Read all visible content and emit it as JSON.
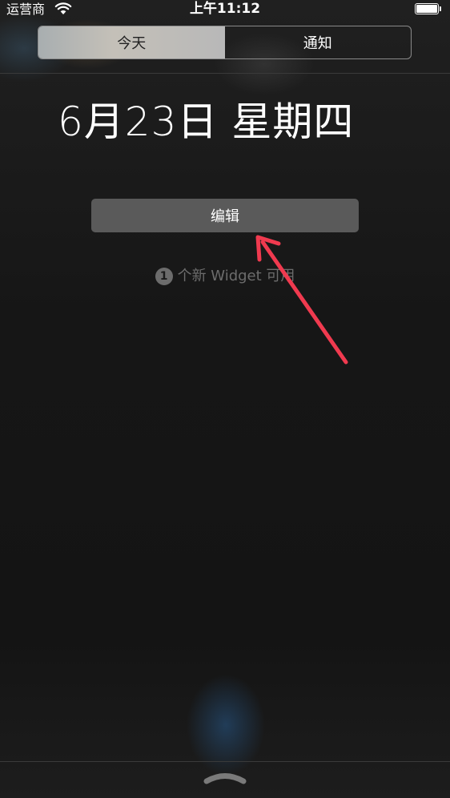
{
  "status_bar": {
    "carrier": "运营商",
    "time": "上午11:12",
    "battery_level": 1.0
  },
  "segmented_control": {
    "tabs": [
      {
        "label": "今天",
        "selected": true
      },
      {
        "label": "通知",
        "selected": false
      }
    ]
  },
  "today": {
    "date": "6月23日 星期四",
    "edit_label": "编辑",
    "new_widget_count": "1",
    "new_widget_text": "个新 Widget 可用"
  },
  "colors": {
    "annotation_arrow": "#f03a4f",
    "background": "#1a1a1a"
  },
  "icons": {
    "wifi": "wifi-icon",
    "battery": "battery-icon",
    "grabber": "chevron-up-icon"
  }
}
